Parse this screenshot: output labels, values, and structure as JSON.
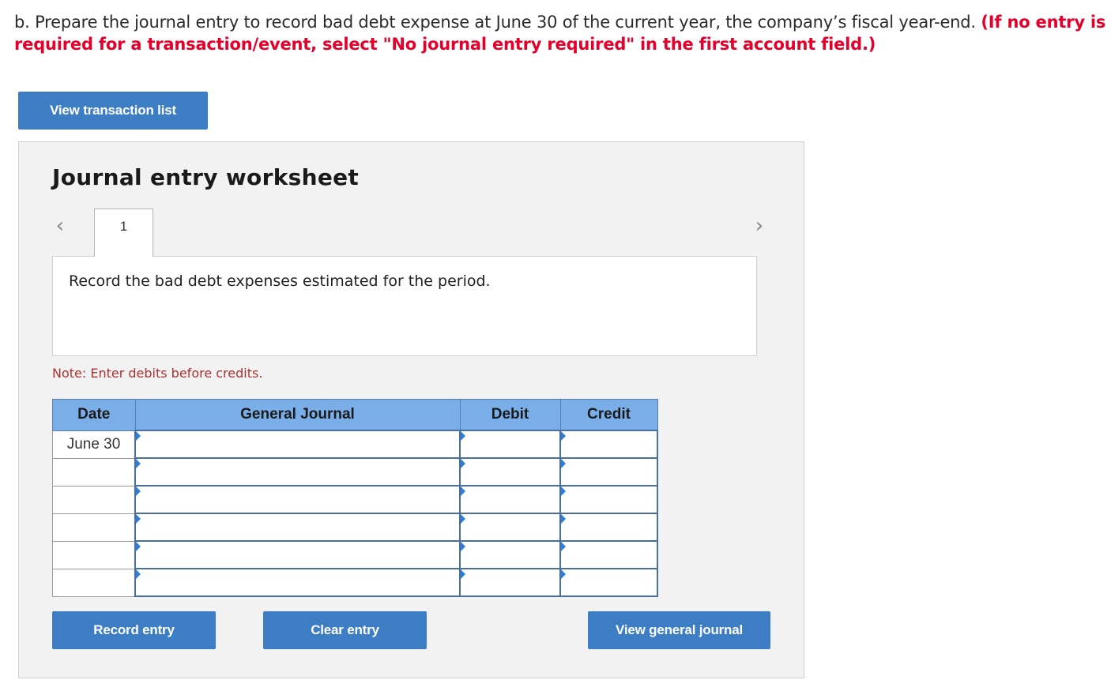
{
  "question": {
    "text": "b. Prepare the journal entry to record bad debt expense at June 30 of the current year, the company’s fiscal year-end.",
    "instruction": "(If no entry is required for a transaction/event, select \"No journal entry required\" in the first account field.)"
  },
  "buttons": {
    "view_transaction_list": "View transaction list",
    "record_entry": "Record entry",
    "clear_entry": "Clear entry",
    "view_general_journal": "View general journal"
  },
  "worksheet": {
    "title": "Journal entry worksheet",
    "tab_label": "1",
    "description": "Record the bad debt expenses estimated for the period.",
    "note": "Note: Enter debits before credits."
  },
  "journal": {
    "headers": {
      "date": "Date",
      "general_journal": "General Journal",
      "debit": "Debit",
      "credit": "Credit"
    },
    "rows": [
      {
        "date": "June 30",
        "account": "",
        "debit": "",
        "credit": ""
      },
      {
        "date": "",
        "account": "",
        "debit": "",
        "credit": ""
      },
      {
        "date": "",
        "account": "",
        "debit": "",
        "credit": ""
      },
      {
        "date": "",
        "account": "",
        "debit": "",
        "credit": ""
      },
      {
        "date": "",
        "account": "",
        "debit": "",
        "credit": ""
      },
      {
        "date": "",
        "account": "",
        "debit": "",
        "credit": ""
      }
    ]
  },
  "icons": {
    "prev": "chevron-left-icon",
    "next": "chevron-right-icon"
  },
  "colors": {
    "accent": "#3c7dc4",
    "header": "#7aaee8",
    "instruction": "#e4002b"
  }
}
